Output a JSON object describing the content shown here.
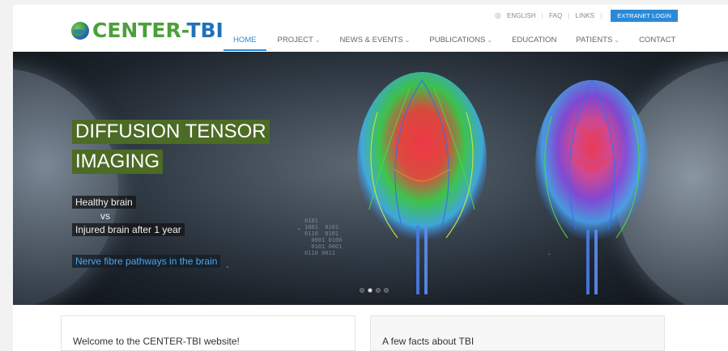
{
  "utility": {
    "language": "ENGLISH",
    "faq": "FAQ",
    "links": "LINKS",
    "extranet": "EXTRANET LOGIN"
  },
  "logo": {
    "part1": "CENTER-",
    "part2": "TBI"
  },
  "nav": [
    {
      "label": "HOME",
      "active": true,
      "dropdown": false
    },
    {
      "label": "PROJECT",
      "dropdown": true
    },
    {
      "label": "NEWS & EVENTS",
      "dropdown": true
    },
    {
      "label": "PUBLICATIONS",
      "dropdown": true
    },
    {
      "label": "EDUCATION",
      "dropdown": false
    },
    {
      "label": "PATIENTS",
      "dropdown": true
    },
    {
      "label": "CONTACT",
      "dropdown": false
    }
  ],
  "hero": {
    "title_line1": "DIFFUSION TENSOR",
    "title_line2": "IMAGING",
    "label1": "Healthy brain",
    "label_vs": "vs",
    "label2": "Injured brain after 1 year",
    "link": "Nerve fibre pathways in the brain",
    "binary": "0101\n1001  0101\n0110  0101\n  0001 0100\n  0101 0001\n0110 0011",
    "slides_total": 4,
    "active_slide": 2
  },
  "cards": {
    "left_title": "Welcome to the CENTER-TBI website!",
    "right_title": "A few facts about TBI"
  },
  "colors": {
    "accent": "#2a8ad8",
    "logo_green": "#4aa03b",
    "logo_blue": "#2172b8",
    "title_bg": "#4c6b25"
  }
}
